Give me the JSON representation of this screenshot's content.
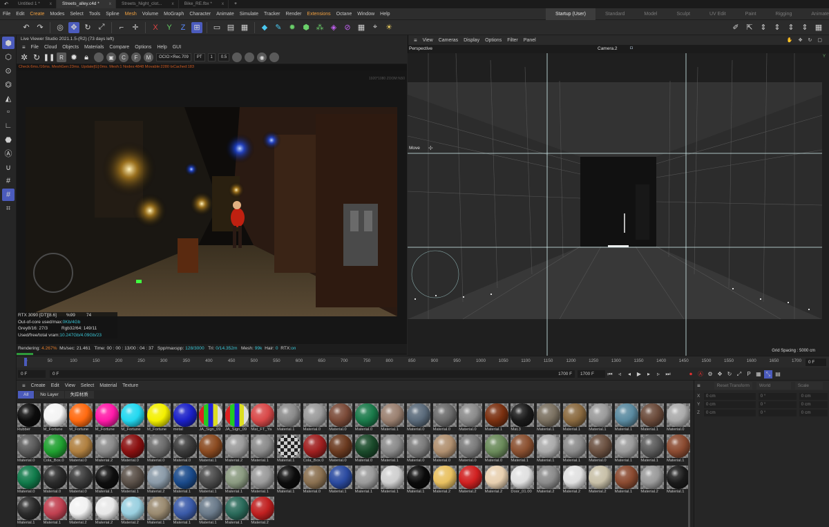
{
  "tabs": [
    {
      "label": "Untitled 1 *",
      "active": false
    },
    {
      "label": "Streets_alley.c4d *",
      "active": true
    },
    {
      "label": "Streets_Night_clot...",
      "active": false
    },
    {
      "label": "Bike_RE.fbx *",
      "active": false
    }
  ],
  "tab_add": "+",
  "tab_close": "x",
  "menu": [
    "File",
    "Edit",
    "Create",
    "Modes",
    "Select",
    "Tools",
    "Spline",
    "Mesh",
    "Volume",
    "MoGraph",
    "Character",
    "Animate",
    "Simulate",
    "Tracker",
    "Render",
    "Extensions",
    "Octane",
    "Window",
    "Help"
  ],
  "menu_highlight": [
    "Create",
    "Mesh",
    "Extensions"
  ],
  "layouts": [
    "Startup (User)",
    "Standard",
    "Model",
    "Sculpt",
    "UV Edit",
    "Paint",
    "Rigging",
    "Animate",
    "Track"
  ],
  "live_viewer": {
    "title": "Live Viewer Studio 2021.1.5-(R2) (73 days left)",
    "menu": [
      "File",
      "Cloud",
      "Objects",
      "Materials",
      "Compare",
      "Options",
      "Help",
      "GUI"
    ],
    "ocio": "OCIO:<Rec.709",
    "mode": "PT",
    "spin1": "1",
    "spin2": "0.5",
    "status": "Check:6ms./16ms. MeshGen:23ms. Update[G]:0ms. Mesh:1 Nodes:4848 Movable:2280 txCached:183",
    "zoom": "1920*1080 ZOOM:%50",
    "info": [
      {
        "label": "RTX 3090 [DT][8.6]",
        "value": "%99",
        "extra": "74"
      },
      {
        "label": "Out-of-core used/max:",
        "value": "0Kb/4Gb"
      },
      {
        "label": "Grey8/16: 27/3",
        "value": "Rgb32/64: 149/11"
      },
      {
        "label": "Used/free/total vram:",
        "value": "10.247Gb/4.09Gb/23"
      }
    ],
    "bottom": {
      "rendering_label": "Rendering:",
      "rendering_value": "4.267%",
      "ms_label": "Ms/sec:",
      "ms_value": "21.461",
      "time_label": "Time:",
      "time_value": "00 : 00 : 13/00 : 04 : 37",
      "spp_label": "Spp/maxspp:",
      "spp_value": "128/3000",
      "tri_label": "Tri:",
      "tri_value": "0/14.352m",
      "mesh_label": "Mesh:",
      "mesh_value": "99k",
      "hair_label": "Hair:",
      "hair_value": "0",
      "rtx_label": "RTX:",
      "rtx_value": "on"
    },
    "progress": 0.04267
  },
  "viewport": {
    "menu": [
      "View",
      "Cameras",
      "Display",
      "Options",
      "Filter",
      "Panel"
    ],
    "label": "Perspective",
    "camera": "Camera.2",
    "tool": "Move",
    "grid_spacing": "Grid Spacing : 5000 cm"
  },
  "timeline": {
    "ticks": [
      "0",
      "50",
      "100",
      "150",
      "200",
      "250",
      "300",
      "350",
      "400",
      "450",
      "500",
      "550",
      "600",
      "650",
      "700",
      "750",
      "800",
      "850",
      "900",
      "950",
      "1000",
      "1050",
      "1100",
      "1150",
      "1200",
      "1250",
      "1300",
      "1350",
      "1400",
      "1450",
      "1500",
      "1550",
      "1600",
      "1650",
      "1700"
    ],
    "current_frame": "0 F",
    "start": "0 F",
    "start2": "0 F",
    "end": "1700 F",
    "end2": "1700 F"
  },
  "material_manager": {
    "menu": [
      "Create",
      "Edit",
      "View",
      "Select",
      "Material",
      "Texture"
    ],
    "filters": [
      "All",
      "No Layer",
      "失踪材质"
    ],
    "materials": [
      {
        "name": "Rubber",
        "c": "#0c0c0c",
        "t": "s"
      },
      {
        "name": "M_Fortune",
        "c": "#f4f4f4",
        "t": "s"
      },
      {
        "name": "M_Fortune",
        "c": "#ff6a10",
        "t": "s"
      },
      {
        "name": "M_Fortune",
        "c": "#ff1aa8",
        "t": "s"
      },
      {
        "name": "M_Fortune",
        "c": "#22d8f0",
        "t": "s"
      },
      {
        "name": "M_Fortune",
        "c": "#f4f000",
        "t": "s"
      },
      {
        "name": "metal",
        "c": "#1a20c8",
        "t": "s"
      },
      {
        "name": "JA_Sign_09",
        "c": "#8a8",
        "t": "p"
      },
      {
        "name": "JA_Sign_09",
        "c": "#99a",
        "t": "p"
      },
      {
        "name": "Mat_FT_Ya",
        "c": "#d84848",
        "t": "s"
      },
      {
        "name": "Material.1",
        "c": "#8a8a8a",
        "t": "s"
      },
      {
        "name": "Material.0",
        "c": "#9a9a9a",
        "t": "s"
      },
      {
        "name": "Material.0",
        "c": "#7a4a38",
        "t": "s"
      },
      {
        "name": "Material.0",
        "c": "#1a7a4a",
        "t": "s"
      },
      {
        "name": "Material.1",
        "c": "#9a8070",
        "t": "s"
      },
      {
        "name": "Material.0",
        "c": "#5a6a7a",
        "t": "s"
      },
      {
        "name": "Material.0",
        "c": "#6a6a6a",
        "t": "s"
      },
      {
        "name": "Material.0",
        "c": "#8a8a8a",
        "t": "s"
      },
      {
        "name": "Material.1",
        "c": "#7a3010",
        "t": "s"
      },
      {
        "name": "Mat.3",
        "c": "#1a1a1a",
        "t": "s"
      },
      {
        "name": "Material.1",
        "c": "#7a7060",
        "t": "s"
      },
      {
        "name": "Material.1",
        "c": "#8a6a40",
        "t": "s"
      },
      {
        "name": "Material.1",
        "c": "#9a9a9a",
        "t": "s"
      },
      {
        "name": "Material.1",
        "c": "#5a8aa0",
        "t": "s"
      },
      {
        "name": "Material.1",
        "c": "#6a4a3a",
        "t": "s"
      },
      {
        "name": "Material.0",
        "c": "#aaaaaa",
        "t": "s"
      },
      {
        "name": "Material.0",
        "c": "#5a5a5a",
        "t": "s"
      },
      {
        "name": "Cola_Box.0",
        "c": "#20a030",
        "t": "s"
      },
      {
        "name": "Material.0",
        "c": "#b08040",
        "t": "s"
      },
      {
        "name": "Material.2",
        "c": "#8a8a8a",
        "t": "s"
      },
      {
        "name": "Material.0",
        "c": "#8a1010",
        "t": "s"
      },
      {
        "name": "Material.0",
        "c": "#6a6a6a",
        "t": "s"
      },
      {
        "name": "Material.0",
        "c": "#3a3a3a",
        "t": "s"
      },
      {
        "name": "Material.1",
        "c": "#8a4a20",
        "t": "s"
      },
      {
        "name": "Material.2",
        "c": "#9a9a9a",
        "t": "s"
      },
      {
        "name": "Material.1",
        "c": "#8a8a8a",
        "t": "s"
      },
      {
        "name": "Material.1",
        "c": "#2a2a2a",
        "t": "c"
      },
      {
        "name": "Cola_Box.0",
        "c": "#a02020",
        "t": "s"
      },
      {
        "name": "Material.0",
        "c": "#6a3a20",
        "t": "s"
      },
      {
        "name": "Material.0",
        "c": "#1a4a2a",
        "t": "s"
      },
      {
        "name": "Material.1",
        "c": "#8a8a8a",
        "t": "s"
      },
      {
        "name": "Material.0",
        "c": "#7a7a7a",
        "t": "s"
      },
      {
        "name": "Material.0",
        "c": "#b09070",
        "t": "s"
      },
      {
        "name": "Material.0",
        "c": "#7a7a7a",
        "t": "s"
      },
      {
        "name": "Material.0",
        "c": "#6a8a5a",
        "t": "s"
      },
      {
        "name": "Material.1",
        "c": "#8a5030",
        "t": "s"
      },
      {
        "name": "Material.1",
        "c": "#aaaaaa",
        "t": "s"
      },
      {
        "name": "Material.1",
        "c": "#8a8a8a",
        "t": "s"
      },
      {
        "name": "Material.0",
        "c": "#6a5040",
        "t": "s"
      },
      {
        "name": "Material.1",
        "c": "#9a9a9a",
        "t": "s"
      },
      {
        "name": "Material.1",
        "c": "#5a5a5a",
        "t": "s"
      },
      {
        "name": "Material.1",
        "c": "#8a4a30",
        "t": "s"
      },
      {
        "name": "Material.0",
        "c": "#107a4a",
        "t": "s"
      },
      {
        "name": "Material.0",
        "c": "#2a2a2a",
        "t": "s"
      },
      {
        "name": "Material.0",
        "c": "#3a3a3a",
        "t": "s"
      },
      {
        "name": "Material.1",
        "c": "#0e0e0e",
        "t": "s"
      },
      {
        "name": "Material.1",
        "c": "#5a5048",
        "t": "s"
      },
      {
        "name": "Material.2",
        "c": "#8a9aa8",
        "t": "s"
      },
      {
        "name": "Material.1",
        "c": "#1a4a8a",
        "t": "s"
      },
      {
        "name": "Material.1",
        "c": "#4a4a4a",
        "t": "s"
      },
      {
        "name": "Material.1",
        "c": "#8a9a80",
        "t": "s"
      },
      {
        "name": "Material.1",
        "c": "#9a9a9a",
        "t": "s"
      },
      {
        "name": "Material.1",
        "c": "#0c0c0c",
        "t": "s"
      },
      {
        "name": "Material.0",
        "c": "#8a7050",
        "t": "s"
      },
      {
        "name": "Material.1",
        "c": "#2a4aa0",
        "t": "s"
      },
      {
        "name": "Material.1",
        "c": "#9a9a9a",
        "t": "s"
      },
      {
        "name": "Material.1",
        "c": "#cfcfcf",
        "t": "s"
      },
      {
        "name": "Material.1",
        "c": "#0a0a0a",
        "t": "s"
      },
      {
        "name": "Material.2",
        "c": "#e8c060",
        "t": "s"
      },
      {
        "name": "Material.2",
        "c": "#d02020",
        "t": "s"
      },
      {
        "name": "Material.2",
        "c": "#e8d0b0",
        "t": "s"
      },
      {
        "name": "Door_01.00",
        "c": "#e0e0e0",
        "t": "s"
      },
      {
        "name": "Material.2",
        "c": "#8a8a8a",
        "t": "s"
      },
      {
        "name": "Material.2",
        "c": "#e0e0e0",
        "t": "s"
      },
      {
        "name": "Material.2",
        "c": "#c8c0a8",
        "t": "s"
      },
      {
        "name": "Material.1",
        "c": "#8a4a30",
        "t": "s"
      },
      {
        "name": "Material.2",
        "c": "#9a9a9a",
        "t": "s"
      },
      {
        "name": "Material.1",
        "c": "#1a1a1a",
        "t": "s"
      },
      {
        "name": "Material.1",
        "c": "#2a2a2a",
        "t": "s"
      },
      {
        "name": "Material.1",
        "c": "#c04050",
        "t": "s"
      },
      {
        "name": "Material.2",
        "c": "#f2f2f2",
        "t": "s"
      },
      {
        "name": "Material.2",
        "c": "#e8e8e8",
        "t": "s"
      },
      {
        "name": "Material.2",
        "c": "#9ad0e0",
        "t": "s"
      },
      {
        "name": "Material.1",
        "c": "#9a8a70",
        "t": "s"
      },
      {
        "name": "Material.1",
        "c": "#3a5aa8",
        "t": "s"
      },
      {
        "name": "Material.1",
        "c": "#6a7a8a",
        "t": "s"
      },
      {
        "name": "Material.1",
        "c": "#2a6a5a",
        "t": "s"
      },
      {
        "name": "Material.2",
        "c": "#c02020",
        "t": "s"
      }
    ]
  },
  "coordinates": {
    "headers": [
      "Reset Transform",
      "World",
      "Scale"
    ],
    "rows": [
      {
        "axis": "X",
        "pos": "0 cm",
        "rot": "0 °",
        "size": "0 cm"
      },
      {
        "axis": "Y",
        "pos": "0 cm",
        "rot": "0 °",
        "size": "0 cm"
      },
      {
        "axis": "Z",
        "pos": "0 cm",
        "rot": "0 °",
        "size": "0 cm"
      }
    ]
  },
  "colors": {
    "accent": "#4b5bbd",
    "highlight": "#f0a040",
    "info_value": "#3ac8d8",
    "status": "#d05a20"
  }
}
